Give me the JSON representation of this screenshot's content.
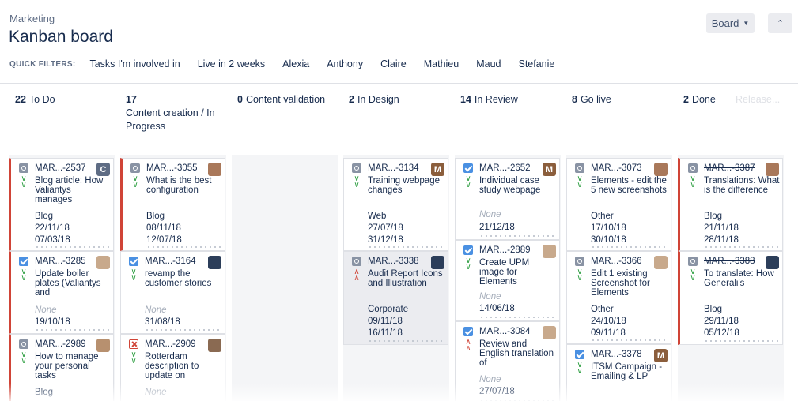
{
  "header": {
    "project": "Marketing",
    "title": "Kanban board",
    "board_button": "Board",
    "collapse_icon": "double-chevron-up-icon"
  },
  "quick_filters": {
    "label": "QUICK FILTERS:",
    "items": [
      "Tasks I'm involved in",
      "Live in 2 weeks",
      "Alexia",
      "Anthony",
      "Claire",
      "Mathieu",
      "Maud",
      "Stefanie"
    ]
  },
  "columns": [
    {
      "count": "22",
      "name": "To Do"
    },
    {
      "count": "17",
      "name": "Content creation / In Progress"
    },
    {
      "count": "0",
      "name": "Content validation"
    },
    {
      "count": "2",
      "name": "In Design"
    },
    {
      "count": "14",
      "name": "In Review"
    },
    {
      "count": "8",
      "name": "Go live"
    },
    {
      "count": "2",
      "name": "Done"
    },
    {
      "count": "",
      "name": "Release..."
    }
  ],
  "colors": {
    "flag_red": "#d04437",
    "task_icon": "#8993a4",
    "done_icon": "#4a90e2",
    "low_priority": "#2a9d3e",
    "high_priority": "#d04437",
    "column_bg": "#f4f5f7"
  },
  "cards": {
    "c0": [
      {
        "key": "MAR...-2537",
        "summary": "Blog article: How Valiantys manages",
        "category": "Blog",
        "date1": "22/11/18",
        "date2": "07/03/18",
        "avatar": "C"
      },
      {
        "key": "MAR...-3285",
        "summary": "Update boiler plates (Valiantys and",
        "category": "None",
        "date1": "19/10/18"
      },
      {
        "key": "MAR...-2989",
        "summary": "How to manage your personal tasks",
        "category": "Blog",
        "date1": ""
      }
    ],
    "c1": [
      {
        "key": "MAR...-3055",
        "summary": "What is the best configuration",
        "category": "Blog",
        "date1": "08/11/18",
        "date2": "12/07/18"
      },
      {
        "key": "MAR...-3164",
        "summary": "revamp the customer stories",
        "category": "None",
        "date1": "31/08/18"
      },
      {
        "key": "MAR...-2909",
        "summary": "Rotterdam description to update on",
        "category": "None",
        "date1": ""
      }
    ],
    "c3": [
      {
        "key": "MAR...-3134",
        "summary": "Training webpage changes",
        "category": "Web",
        "date1": "27/07/18",
        "date2": "31/12/18",
        "avatar": "M"
      },
      {
        "key": "MAR...-3338",
        "summary": "Audit Report Icons and Illustration",
        "category": "Corporate",
        "date1": "09/11/18",
        "date2": "16/11/18"
      }
    ],
    "c4": [
      {
        "key": "MAR...-2652",
        "summary": "Individual case study webpage",
        "category": "None",
        "date1": "21/12/18",
        "avatar": "M"
      },
      {
        "key": "MAR...-2889",
        "summary": "Create UPM image for Elements",
        "category": "None",
        "date1": "14/06/18"
      },
      {
        "key": "MAR...-3084",
        "summary": "Review and English translation of",
        "category": "None",
        "date1": "27/07/18"
      }
    ],
    "c5": [
      {
        "key": "MAR...-3073",
        "summary": "Elements - edit the 5 new screenshots",
        "category": "Other",
        "date1": "17/10/18",
        "date2": "30/10/18"
      },
      {
        "key": "MAR...-3366",
        "summary": "Edit 1 existing Screenshot for Elements",
        "category": "Other",
        "date1": "24/10/18",
        "date2": "09/11/18"
      },
      {
        "key": "MAR...-3378",
        "summary": "ITSM Campaign - Emailing & LP",
        "avatar": "M"
      }
    ],
    "c6": [
      {
        "key": "MAR...-3387",
        "summary": "Translations: What is the difference",
        "category": "Blog",
        "date1": "21/11/18",
        "date2": "28/11/18"
      },
      {
        "key": "MAR...-3388",
        "summary": "To translate: How Generali's",
        "category": "Blog",
        "date1": "29/11/18",
        "date2": "05/12/18"
      }
    ]
  }
}
